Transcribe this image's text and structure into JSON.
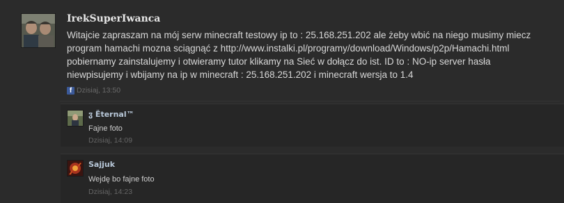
{
  "post": {
    "author": "IrekSuperIwanca",
    "text_before_link": "Witajcie zapraszam na mój serw minecraft testowy ip to : 25.168.251.202 ale żeby wbić na niego musimy miecz program hamachi mozna sciągnąć z ",
    "link_text": "http://www.instalki.pl/programy/download/Windows/p2p/Hamachi.html",
    "text_after_link": " pobiernamy zainstalujemy i otwieramy tutor klikamy na Sieć w dołącz do ist. ID to : NO-ip server hasła niewpisujemy i wbijamy na ip w minecraft : 25.168.251.202 i minecraft wersja to 1.4",
    "timestamp": "Dzisiaj, 13:50",
    "source_icon": "facebook-icon"
  },
  "comments": [
    {
      "author": "ჳ Ëternal™",
      "text": "Fajne foto",
      "timestamp": "Dzisiaj, 14:09"
    },
    {
      "author": "Sajjuk",
      "text": "Wejdę bo fajne foto",
      "timestamp": "Dzisiaj, 14:23"
    }
  ],
  "colors": {
    "background": "#2b2b2b",
    "comment_background": "#262626",
    "author_name": "#e8e8e8",
    "comment_author": "#b9c9da",
    "body_text": "#d8d8d8",
    "muted": "#6b6b6b",
    "facebook": "#3b5998"
  }
}
